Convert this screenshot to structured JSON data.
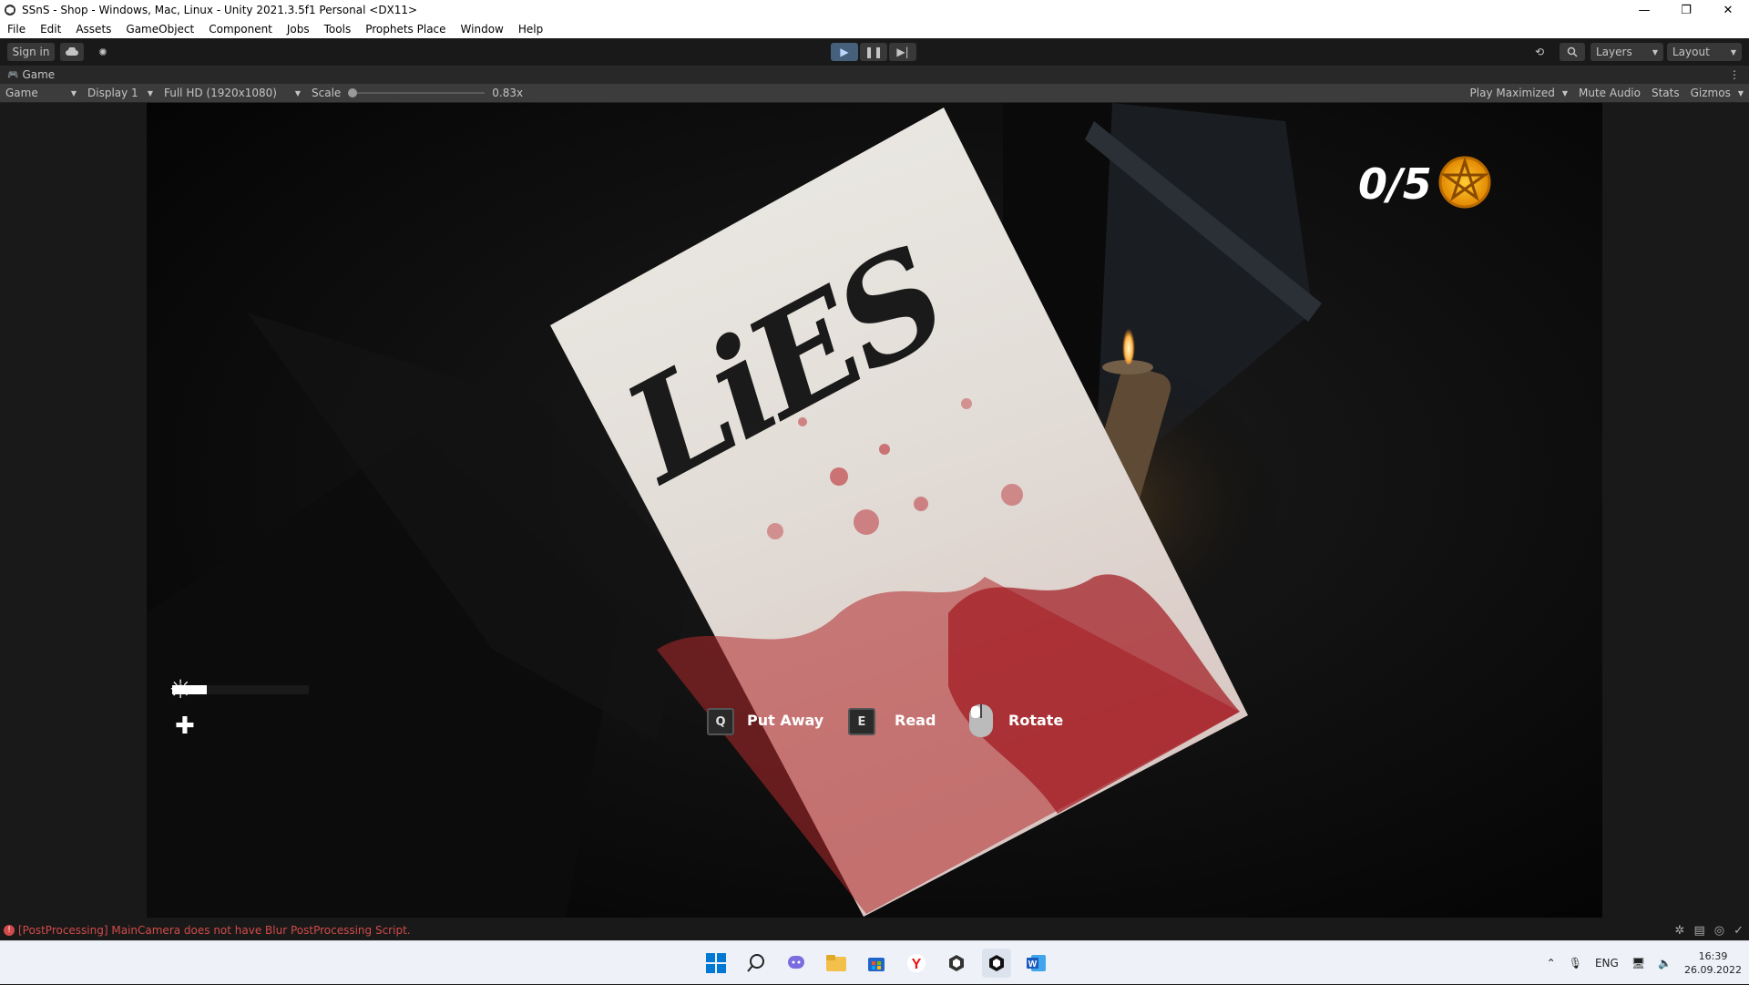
{
  "window": {
    "title": "SSnS - Shop - Windows, Mac, Linux - Unity 2021.3.5f1 Personal <DX11>",
    "minimize": "—",
    "maximize": "❐",
    "close": "✕"
  },
  "menu": [
    "File",
    "Edit",
    "Assets",
    "GameObject",
    "Component",
    "Jobs",
    "Tools",
    "Prophets Place",
    "Window",
    "Help"
  ],
  "toolbar": {
    "sign_in": "Sign in",
    "layers": "Layers",
    "layout": "Layout"
  },
  "tab": {
    "label": "Game"
  },
  "gamebar": {
    "view": "Game",
    "display": "Display 1",
    "resolution": "Full HD (1920x1080)",
    "scale_label": "Scale",
    "scale_value": "0.83x",
    "play_maximized": "Play Maximized",
    "mute_audio": "Mute Audio",
    "stats": "Stats",
    "gizmos": "Gizmos"
  },
  "game": {
    "counter": "0/5",
    "note_text": "LiES",
    "prompts": [
      {
        "key": "Q",
        "label": "Put Away"
      },
      {
        "key": "E",
        "label": "Read"
      },
      {
        "key": "",
        "label": "Rotate"
      }
    ],
    "light_level": 0.25
  },
  "status": {
    "message": "[PostProcessing] MainCamera does not have Blur PostProcessing Script."
  },
  "taskbar": {
    "lang": "ENG",
    "time": "16:39",
    "date": "26.09.2022"
  },
  "colors": {
    "play_active": "#46607c",
    "error": "#d24a4a",
    "pentagram": "#f5a20a"
  }
}
